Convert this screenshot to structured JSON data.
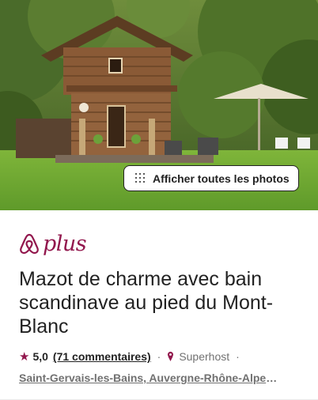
{
  "hero": {
    "photos_button_label": "Afficher toutes les photos",
    "photos_icon": "grid-dots-icon"
  },
  "brand": {
    "logo_icon": "airbnb-belo-icon",
    "plus_text": "plus",
    "color": "#92174D"
  },
  "listing": {
    "title": "Mazot de charme avec bain scandinave au pied du Mont-Blanc",
    "rating": "5,0",
    "reviews_label": "(71 commentaires)",
    "separator": "·",
    "superhost_label": "Superhost",
    "location": "Saint-Gervais-les-Bains, Auvergne-Rhône-Alpes, France"
  },
  "colors": {
    "text": "#222222",
    "muted": "#717171",
    "accent": "#92174D"
  }
}
